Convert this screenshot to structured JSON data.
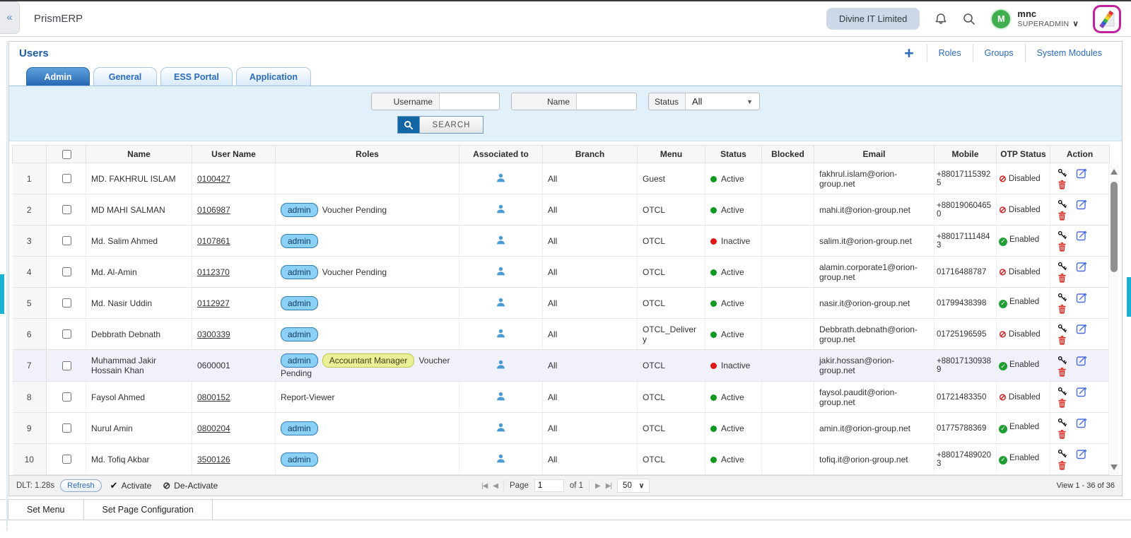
{
  "topbar": {
    "app_title": "PrismERP",
    "company_button": "Divine IT Limited",
    "user": {
      "initial": "M",
      "name": "mnc",
      "role": "SUPERADMIN"
    }
  },
  "page": {
    "title": "Users",
    "plus_label": "+",
    "links": [
      "Roles",
      "Groups",
      "System Modules"
    ],
    "tabs": [
      "Admin",
      "General",
      "ESS Portal",
      "Application"
    ],
    "active_tab": "Admin"
  },
  "filters": {
    "username_label": "Username",
    "username_value": "",
    "name_label": "Name",
    "name_value": "",
    "status_label": "Status",
    "status_value": "All",
    "search_label": "SEARCH"
  },
  "table": {
    "columns": [
      "Name",
      "User Name",
      "Roles",
      "Associated to",
      "Branch",
      "Menu",
      "Status",
      "Blocked",
      "Email",
      "Mobile",
      "OTP Status",
      "Action"
    ],
    "rows": [
      {
        "no": 1,
        "name": "MD. FAKHRUL ISLAM",
        "username": "0100427",
        "username_link": true,
        "badges": [],
        "roles_text": "",
        "branch": "All",
        "menu": "Guest",
        "status": "Active",
        "blocked": "",
        "email": "fakhrul.islam@orion-group.net",
        "mobile": "+880171153925",
        "otp": "Disabled",
        "highlighted": false
      },
      {
        "no": 2,
        "name": "MD MAHI SALMAN",
        "username": "0106987",
        "username_link": true,
        "badges": [
          {
            "label": "admin",
            "type": "blue"
          }
        ],
        "roles_text": "Voucher Pending",
        "branch": "All",
        "menu": "OTCL",
        "status": "Active",
        "blocked": "",
        "email": "mahi.it@orion-group.net",
        "mobile": "+880190604650",
        "otp": "Disabled",
        "highlighted": false
      },
      {
        "no": 3,
        "name": "Md. Salim Ahmed",
        "username": "0107861",
        "username_link": true,
        "badges": [
          {
            "label": "admin",
            "type": "blue"
          }
        ],
        "roles_text": "",
        "branch": "All",
        "menu": "OTCL",
        "status": "Inactive",
        "blocked": "",
        "email": "salim.it@orion-group.net",
        "mobile": "+880171114843",
        "otp": "Enabled",
        "highlighted": false
      },
      {
        "no": 4,
        "name": "Md. Al-Amin",
        "username": "0112370",
        "username_link": true,
        "badges": [
          {
            "label": "admin",
            "type": "blue"
          }
        ],
        "roles_text": "Voucher Pending",
        "branch": "All",
        "menu": "OTCL",
        "status": "Active",
        "blocked": "",
        "email": "alamin.corporate1@orion-group.net",
        "mobile": "01716488787",
        "otp": "Disabled",
        "highlighted": false
      },
      {
        "no": 5,
        "name": "Md. Nasir Uddin",
        "username": "0112927",
        "username_link": true,
        "badges": [
          {
            "label": "admin",
            "type": "blue"
          }
        ],
        "roles_text": "",
        "branch": "All",
        "menu": "OTCL",
        "status": "Active",
        "blocked": "",
        "email": "nasir.it@orion-group.net",
        "mobile": "01799438398",
        "otp": "Enabled",
        "highlighted": false
      },
      {
        "no": 6,
        "name": "Debbrath Debnath",
        "username": "0300339",
        "username_link": true,
        "badges": [
          {
            "label": "admin",
            "type": "blue"
          }
        ],
        "roles_text": "",
        "branch": "All",
        "menu": "OTCL_Delivery",
        "status": "Active",
        "blocked": "",
        "email": "Debbrath.debnath@orion-group.net",
        "mobile": "01725196595",
        "otp": "Disabled",
        "highlighted": false
      },
      {
        "no": 7,
        "name": "Muhammad Jakir Hossain Khan",
        "username": "0600001",
        "username_link": false,
        "badges": [
          {
            "label": "admin",
            "type": "blue"
          },
          {
            "label": "Accountant Manager",
            "type": "yellow"
          }
        ],
        "roles_text": "Voucher Pending",
        "branch": "All",
        "menu": "OTCL",
        "status": "Inactive",
        "blocked": "",
        "email": "jakir.hossan@orion-group.net",
        "mobile": "+880171309389",
        "otp": "Enabled",
        "highlighted": true
      },
      {
        "no": 8,
        "name": "Faysol Ahmed",
        "username": "0800152",
        "username_link": true,
        "badges": [],
        "roles_text": "Report-Viewer",
        "branch": "All",
        "menu": "OTCL",
        "status": "Active",
        "blocked": "",
        "email": "faysol.paudit@orion-group.net",
        "mobile": "01721483350",
        "otp": "Disabled",
        "highlighted": false
      },
      {
        "no": 9,
        "name": "Nurul Amin",
        "username": "0800204",
        "username_link": true,
        "badges": [
          {
            "label": "admin",
            "type": "blue"
          }
        ],
        "roles_text": "",
        "branch": "All",
        "menu": "OTCL",
        "status": "Active",
        "blocked": "",
        "email": "amin.it@orion-group.net",
        "mobile": "01775788369",
        "otp": "Enabled",
        "highlighted": false
      },
      {
        "no": 10,
        "name": "Md. Tofiq Akbar",
        "username": "3500126",
        "username_link": true,
        "badges": [
          {
            "label": "admin",
            "type": "blue"
          }
        ],
        "roles_text": "",
        "branch": "All",
        "menu": "OTCL",
        "status": "Active",
        "blocked": "",
        "email": "tofiq.it@orion-group.net",
        "mobile": "+880174890203",
        "otp": "Enabled",
        "highlighted": false
      }
    ]
  },
  "footer": {
    "dlt_text": "DLT: 1.28s",
    "refresh_label": "Refresh",
    "activate_label": "Activate",
    "deactivate_label": "De-Activate",
    "pager": {
      "first": "|◀",
      "prev": "◀",
      "page_label": "Page",
      "page_value": "1",
      "of_label": "of 1",
      "next": "▶",
      "last": "▶|",
      "page_size": "50"
    },
    "view_text": "View 1 - 36 of 36"
  },
  "bottom_tabs": [
    "Set Menu",
    "Set Page Configuration"
  ],
  "icons": {
    "collapse": "«",
    "bell": "bell-outline",
    "search": "magnifier",
    "chevron_down": "∨",
    "plus": "+",
    "person": "person-silhouette",
    "key": "key",
    "edit": "pencil-square",
    "delete": "trash",
    "activate": "✔",
    "deactivate": "⊘",
    "otp_enabled": "✓",
    "otp_disabled": "⊘"
  },
  "colors": {
    "accent_blue": "#2a6bbf",
    "tab_active_blue": "#2767b4",
    "active_green": "#0f9a1f",
    "inactive_red": "#e01818",
    "badge_blue": "#8bd0f5",
    "badge_yellow": "#e9f098",
    "highlight_row": "#f1f1fb",
    "filter_bg": "#e1f0fb",
    "teal_marker": "#1ab2d3",
    "logo_border": "#c2219e",
    "avatar_green": "#3fae4c"
  }
}
